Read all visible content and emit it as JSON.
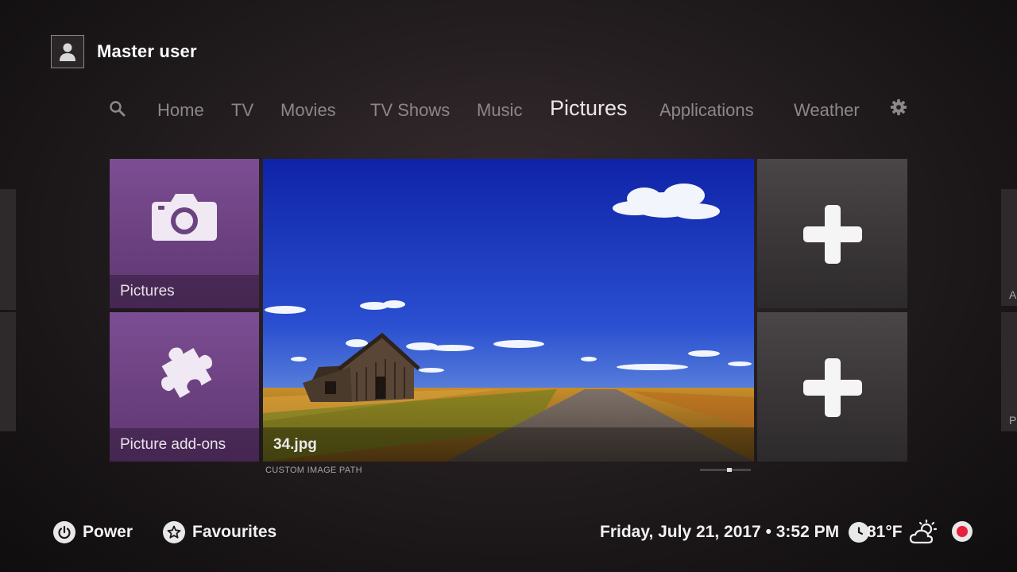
{
  "user": {
    "name": "Master user",
    "avatar_icon": "user-silhouette-icon"
  },
  "nav": {
    "search_icon": "search-icon",
    "items": [
      "Home",
      "TV",
      "Movies",
      "TV Shows",
      "Music",
      "Pictures",
      "Applications",
      "Weather"
    ],
    "active": "Pictures",
    "settings_icon": "gear-icon"
  },
  "tiles": {
    "pictures": {
      "label": "Pictures",
      "icon": "camera-icon"
    },
    "addons": {
      "label": "Picture add-ons",
      "icon": "puzzle-icon"
    },
    "add_1_icon": "plus-icon",
    "add_2_icon": "plus-icon"
  },
  "preview": {
    "caption": "34.jpg",
    "path_label": "CUSTOM IMAGE PATH"
  },
  "footer": {
    "power_label": "Power",
    "favourites_label": "Favourites",
    "datetime": "Friday, July 21, 2017 • 3:52 PM",
    "temperature": "81°F",
    "weather_icon": "partly-cloudy-icon",
    "record_icon": "record-icon"
  },
  "side_peek": {
    "right_top": "A",
    "right_bottom": "P"
  },
  "colors": {
    "accent_purple": "#6e4483",
    "record_red": "#e8203a"
  }
}
